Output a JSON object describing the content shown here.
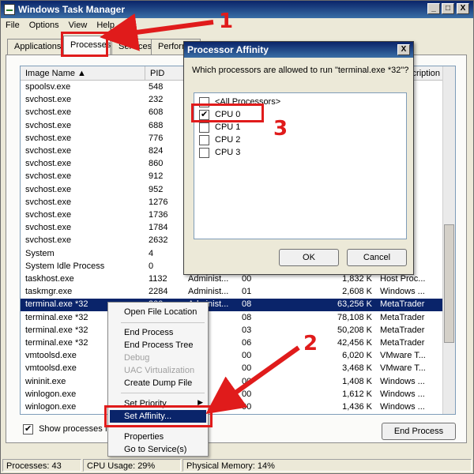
{
  "window": {
    "title": "Windows Task Manager",
    "controls": [
      "_",
      "□",
      "X"
    ]
  },
  "menu": [
    "File",
    "Options",
    "View",
    "Help"
  ],
  "tabs": [
    "Applications",
    "Processes",
    "Services",
    "Performa"
  ],
  "columns": [
    "Image Name",
    "PID",
    "Description"
  ],
  "processes": [
    {
      "name": "spoolsv.exe",
      "pid": "548"
    },
    {
      "name": "svchost.exe",
      "pid": "232"
    },
    {
      "name": "svchost.exe",
      "pid": "608"
    },
    {
      "name": "svchost.exe",
      "pid": "688"
    },
    {
      "name": "svchost.exe",
      "pid": "776"
    },
    {
      "name": "svchost.exe",
      "pid": "824"
    },
    {
      "name": "svchost.exe",
      "pid": "860"
    },
    {
      "name": "svchost.exe",
      "pid": "912"
    },
    {
      "name": "svchost.exe",
      "pid": "952"
    },
    {
      "name": "svchost.exe",
      "pid": "1276"
    },
    {
      "name": "svchost.exe",
      "pid": "1736"
    },
    {
      "name": "svchost.exe",
      "pid": "1784"
    },
    {
      "name": "svchost.exe",
      "pid": "2632"
    },
    {
      "name": "System",
      "pid": "4"
    },
    {
      "name": "System Idle Process",
      "pid": "0"
    },
    {
      "name": "taskhost.exe",
      "pid": "1132",
      "user": "Administ...",
      "cpu": "00",
      "mem": "1,832 K",
      "desc": "Host Proc..."
    },
    {
      "name": "taskmgr.exe",
      "pid": "2284",
      "user": "Administ...",
      "cpu": "01",
      "mem": "2,608 K",
      "desc": "Windows ..."
    },
    {
      "name": "terminal.exe *32",
      "pid": "300",
      "user": "Administ...",
      "cpu": "08",
      "mem": "63,256 K",
      "desc": "MetaTrader"
    },
    {
      "name": "terminal.exe *32",
      "pid": "",
      "user": "",
      "cpu": "08",
      "mem": "78,108 K",
      "desc": "MetaTrader"
    },
    {
      "name": "terminal.exe *32",
      "pid": "",
      "user": "",
      "cpu": "03",
      "mem": "50,208 K",
      "desc": "MetaTrader"
    },
    {
      "name": "terminal.exe *32",
      "pid": "",
      "user": "",
      "cpu": "06",
      "mem": "42,456 K",
      "desc": "MetaTrader"
    },
    {
      "name": "vmtoolsd.exe",
      "pid": "",
      "user": "EM",
      "cpu": "00",
      "mem": "6,020 K",
      "desc": "VMware T..."
    },
    {
      "name": "vmtoolsd.exe",
      "pid": "",
      "user": "EM",
      "cpu": "00",
      "mem": "3,468 K",
      "desc": "VMware T..."
    },
    {
      "name": "wininit.exe",
      "pid": "",
      "user": "EM",
      "cpu": "00",
      "mem": "1,408 K",
      "desc": "Windows ..."
    },
    {
      "name": "winlogon.exe",
      "pid": "",
      "user": "EM",
      "cpu": "00",
      "mem": "1,612 K",
      "desc": "Windows ..."
    },
    {
      "name": "winlogon.exe",
      "pid": "",
      "user": "EM",
      "cpu": "00",
      "mem": "1,436 K",
      "desc": "Windows ..."
    }
  ],
  "selected_row": 17,
  "show_all_label": "Show processes fro",
  "end_process_label": "End Process",
  "context_menu": {
    "items": [
      {
        "label": "Open File Location",
        "state": "normal"
      },
      {
        "label": "End Process",
        "state": "normal"
      },
      {
        "label": "End Process Tree",
        "state": "normal"
      },
      {
        "label": "Debug",
        "state": "disabled"
      },
      {
        "label": "UAC Virtualization",
        "state": "disabled"
      },
      {
        "label": "Create Dump File",
        "state": "normal"
      },
      {
        "label": "Set Priority",
        "state": "submenu"
      },
      {
        "label": "Set Affinity...",
        "state": "highlighted"
      },
      {
        "label": "Properties",
        "state": "normal"
      },
      {
        "label": "Go to Service(s)",
        "state": "normal"
      }
    ]
  },
  "dialog": {
    "title": "Processor Affinity",
    "close": "X",
    "question": "Which processors are allowed to run \"terminal.exe *32\"?",
    "options": [
      {
        "label": "<All Processors>",
        "checked": false
      },
      {
        "label": "CPU 0",
        "checked": true
      },
      {
        "label": "CPU 1",
        "checked": false
      },
      {
        "label": "CPU 2",
        "checked": false
      },
      {
        "label": "CPU 3",
        "checked": false
      }
    ],
    "ok_label": "OK",
    "cancel_label": "Cancel"
  },
  "status": {
    "processes": "Processes: 43",
    "cpu": "CPU Usage: 29%",
    "memory": "Physical Memory: 14%"
  },
  "annotations": {
    "step1": "1",
    "step2": "2",
    "step3": "3",
    "color": "#e01b1b"
  }
}
